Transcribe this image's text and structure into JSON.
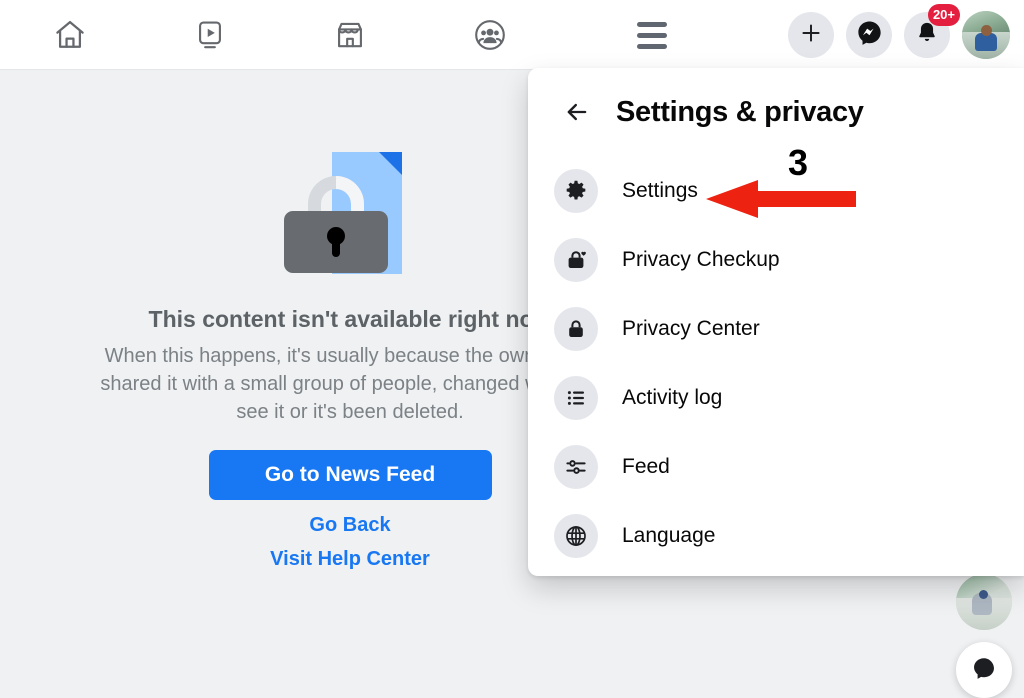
{
  "topbar": {
    "nav_tabs": [
      {
        "name": "home",
        "icon": "home-icon",
        "label": "Home"
      },
      {
        "name": "video",
        "icon": "video-icon",
        "label": "Video"
      },
      {
        "name": "marketplace",
        "icon": "marketplace-icon",
        "label": "Marketplace"
      },
      {
        "name": "groups",
        "icon": "groups-icon",
        "label": "Groups"
      }
    ],
    "menu_button": {
      "icon": "hamburger-icon",
      "label": "Menu"
    },
    "create_button": {
      "icon": "plus-icon",
      "label": "Create"
    },
    "messenger_button": {
      "icon": "messenger-icon",
      "label": "Messenger"
    },
    "notifications_button": {
      "icon": "bell-icon",
      "label": "Notifications",
      "badge": "20+"
    },
    "account_avatar": {
      "icon": "avatar",
      "label": "Account"
    }
  },
  "content": {
    "illustration": {
      "icon": "locked-document-icon",
      "doc_color": "#99caff",
      "fold_color": "#1d72e8",
      "lock_color": "#686b6f"
    },
    "title": "This content isn't available right now",
    "body_lines": [
      "When this happens, it's usually because the owner only",
      "shared it with a small group of people, changed who can",
      "see it or it's been deleted."
    ],
    "primary_button": "Go to News Feed",
    "links": [
      "Go Back",
      "Visit Help Center"
    ]
  },
  "menu": {
    "back_icon": "back-arrow-icon",
    "title": "Settings & privacy",
    "items": [
      {
        "label": "Settings",
        "icon": "gear-icon"
      },
      {
        "label": "Privacy Checkup",
        "icon": "lock-heart-icon"
      },
      {
        "label": "Privacy Center",
        "icon": "lock-icon"
      },
      {
        "label": "Activity log",
        "icon": "list-icon"
      },
      {
        "label": "Feed",
        "icon": "sliders-icon"
      },
      {
        "label": "Language",
        "icon": "globe-icon"
      }
    ]
  },
  "annotation": {
    "number": "3",
    "arrow_color": "#ee2211",
    "icon": "left-arrow-annotation"
  },
  "floating": {
    "contact_avatar": {
      "icon": "contact-avatar"
    },
    "chat_button": {
      "icon": "chat-bubble-icon"
    }
  },
  "colors": {
    "page_background": "#eff1f3",
    "accent_blue": "#1877f2",
    "badge_red": "#e41e3f",
    "panel_white": "#ffffff"
  }
}
